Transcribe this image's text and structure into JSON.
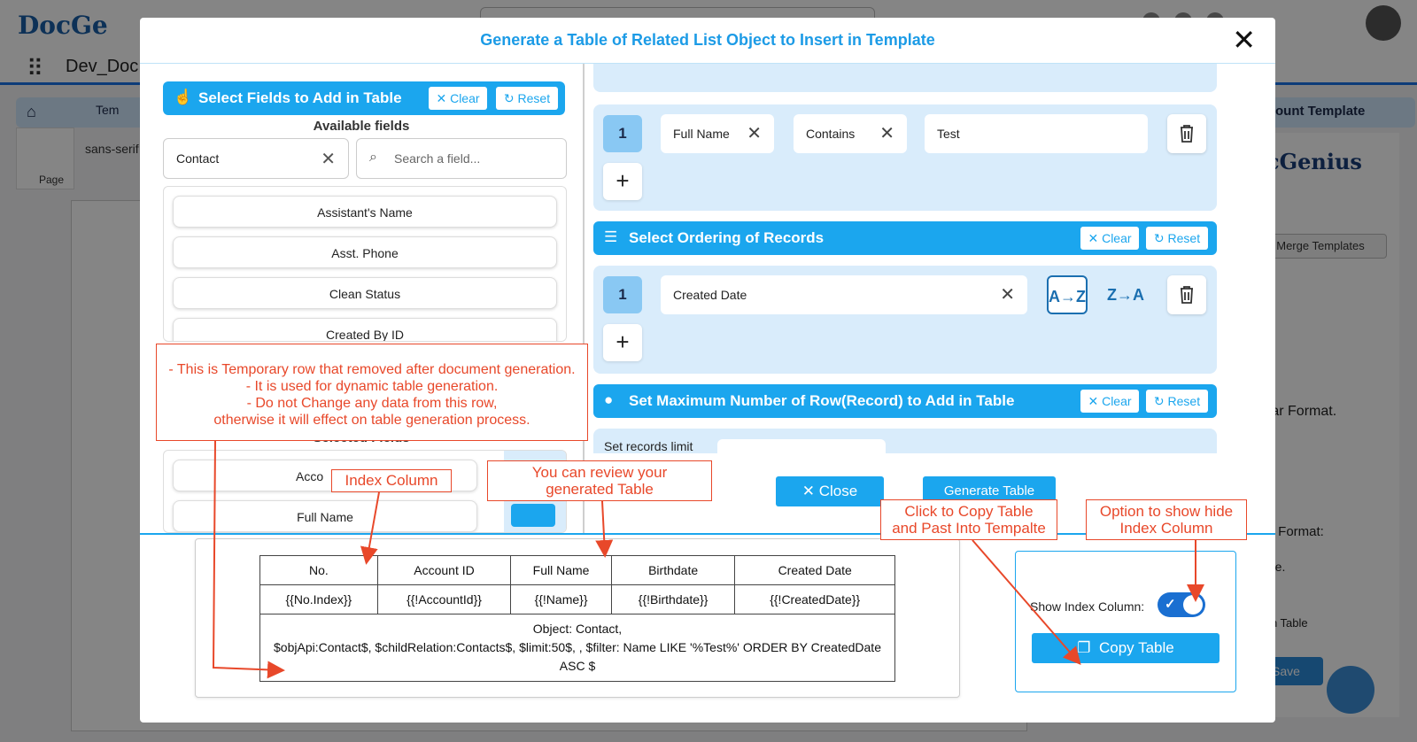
{
  "background": {
    "logo": "DocGe",
    "app_name": "Dev_Doc",
    "tab_temp": "Tem",
    "tab_right": "ount Template",
    "page_label": "Page",
    "font_label": "sans-serif",
    "right_logo": "ocGenius",
    "merge_button": "Merge Templates",
    "rtext1": "pular Format.",
    "rtext2": "ular Format:",
    "rtext3": "Table.",
    "rtext4": "ay In Table",
    "save_button": "Save"
  },
  "modal": {
    "title": "Generate a Table of Related List Object to Insert in Template",
    "close_label": "✕"
  },
  "left": {
    "section_title": "Select Fields to Add in Table",
    "clear_label": "Clear",
    "reset_label": "Reset",
    "available_fields_heading": "Available fields",
    "object_value": "Contact",
    "search_placeholder": "Search a field...",
    "available_fields": [
      "Assistant's Name",
      "Asst. Phone",
      "Clean Status",
      "Created By ID"
    ],
    "selected_fields_heading": "Selected Fields",
    "selected_fields": [
      "Acco",
      "Full Name"
    ]
  },
  "right": {
    "filter_row": {
      "index": "1",
      "field": "Full Name",
      "operator": "Contains",
      "value": "Test"
    },
    "add_symbol": "+",
    "ordering": {
      "title": "Select Ordering of Records",
      "clear_label": "Clear",
      "reset_label": "Reset",
      "index": "1",
      "field": "Created Date",
      "asc_label": "A→Z",
      "desc_label": "Z→A"
    },
    "max_rows": {
      "title": "Set Maximum Number of Row(Record) to Add in Table",
      "clear_label": "Clear",
      "reset_label": "Reset",
      "limit_label": "Set records limit"
    },
    "close_button": "Close",
    "generate_button": "Generate Table"
  },
  "preview": {
    "headers": [
      "No.",
      "Account ID",
      "Full Name",
      "Birthdate",
      "Created Date"
    ],
    "row": [
      "{{No.Index}}",
      "{{!AccountId}}",
      "{{!Name}}",
      "{{!Birthdate}}",
      "{{!CreatedDate}}"
    ],
    "info_line1": "Object: Contact,",
    "info_line2": "$objApi:Contact$, $childRelation:Contacts$, $limit:50$, , $filter: Name LIKE '%Test%' ORDER BY CreatedDate",
    "info_line3": "ASC $"
  },
  "copy_panel": {
    "show_index_label": "Show Index Column:",
    "show_index_value": true,
    "copy_button": "Copy Table"
  },
  "annotations": {
    "temp_row_line1": "- This is Temporary row that removed after document generation.",
    "temp_row_line2": "- It is used for dynamic table generation.",
    "temp_row_line3": "- Do not Change any data from this row,",
    "temp_row_line4": "otherwise it will effect on table generation process.",
    "index_column": "Index Column",
    "review_line1": "You can review your",
    "review_line2": "generated Table",
    "copy_line1": "Click to Copy Table",
    "copy_line2": "and Past Into Tempalte",
    "option_line1": "Option to show hide",
    "option_line2": "Index Column"
  },
  "colors": {
    "accent": "#1ba6ee",
    "title": "#1c9be6",
    "block_bg": "#d9ecfb",
    "annotation": "#e8482a"
  }
}
